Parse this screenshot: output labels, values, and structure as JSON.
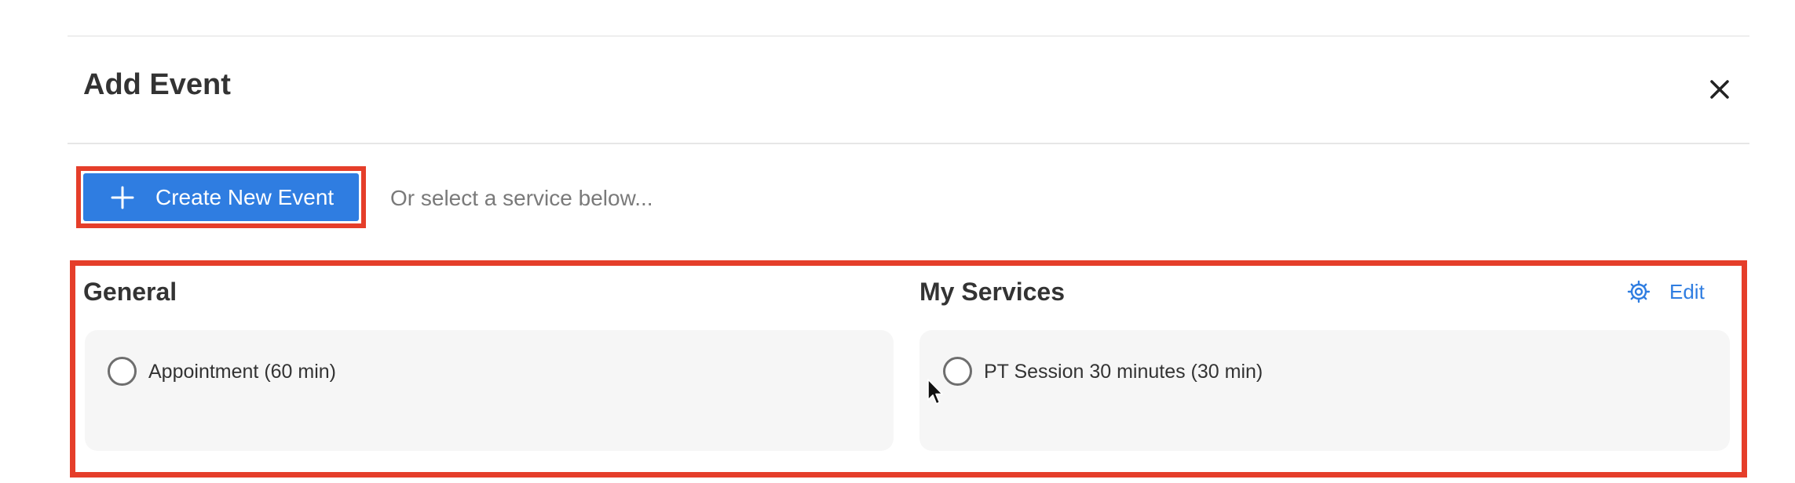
{
  "modal": {
    "title": "Add Event",
    "close_icon": "close-icon"
  },
  "actions": {
    "create_label": "Create New Event",
    "create_icon": "plus-icon",
    "hint": "Or select a service below..."
  },
  "sections": {
    "general": {
      "title": "General",
      "options": [
        {
          "label": "Appointment (60 min)",
          "selected": false
        }
      ]
    },
    "my_services": {
      "title": "My Services",
      "edit_label": "Edit",
      "edit_icon": "gear-icon",
      "options": [
        {
          "label": "PT Session 30 minutes (30 min)",
          "selected": false
        }
      ]
    }
  },
  "colors": {
    "accent": "#2f7de1",
    "highlight": "#e53e2a",
    "card_background": "#f6f6f6",
    "text": "#333333",
    "muted_text": "#7a7a7a"
  }
}
